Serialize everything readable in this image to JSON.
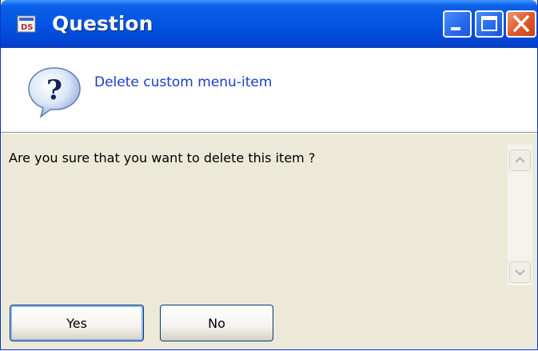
{
  "window": {
    "title": "Question",
    "app_icon": "ds-app-icon",
    "controls": {
      "minimize": "minimize-icon",
      "maximize": "maximize-icon",
      "close": "close-icon"
    }
  },
  "header": {
    "icon": "question-mark-icon",
    "text": "Delete custom menu-item"
  },
  "body": {
    "message": "Are you sure that you want to delete this item ?"
  },
  "buttons": {
    "yes_label": "Yes",
    "no_label": "No"
  },
  "colors": {
    "title_bar": "#0355e3",
    "header_text": "#1c3cc8",
    "body_background": "#ece9d8",
    "close_button": "#e05a2c"
  }
}
